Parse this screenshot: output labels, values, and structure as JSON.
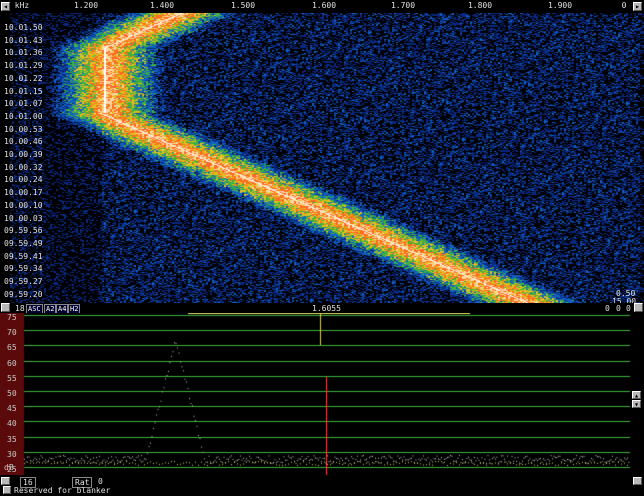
{
  "freq_scale": {
    "unit": "kHz",
    "ticks": [
      "1.200",
      "1.400",
      "1.500",
      "1.600",
      "1.700",
      "1.800",
      "1.900"
    ]
  },
  "waterfall": {
    "time_labels": [
      "10.01.50",
      "10.01.43",
      "10.01.36",
      "10.01.29",
      "10.01.22",
      "10.01.15",
      "10.01.07",
      "10.01.00",
      "10.00.53",
      "10.00.46",
      "10.00.39",
      "10.00.32",
      "10.00.24",
      "10.00.17",
      "10.00.10",
      "10.00.03",
      "09.59.56",
      "09.59.49",
      "09.59.41",
      "09.59.34",
      "09.59.27",
      "09.59.20"
    ],
    "right_readouts": [
      "0.50",
      "15.00"
    ],
    "top_right": "0"
  },
  "divider": {
    "left_value": "18",
    "tabs": [
      "ASC",
      "A2",
      "A4",
      "H2"
    ],
    "cursor_freq": "1.6055",
    "right_flags": [
      "0",
      "0",
      "0"
    ]
  },
  "spectrum": {
    "db_labels": [
      "75",
      "70",
      "65",
      "60",
      "55",
      "50",
      "45",
      "40",
      "35",
      "30",
      "25"
    ],
    "bottom_left": "dB",
    "colors": {
      "grid": "#3cb43c",
      "marker": "#ff4040",
      "cursor": "#d8d060",
      "trace": "#c8c8c8"
    }
  },
  "status_bar": {
    "num_field": "16",
    "rat_label": "Rat",
    "rat_value": "0",
    "message": "Reserved for blanker"
  }
}
